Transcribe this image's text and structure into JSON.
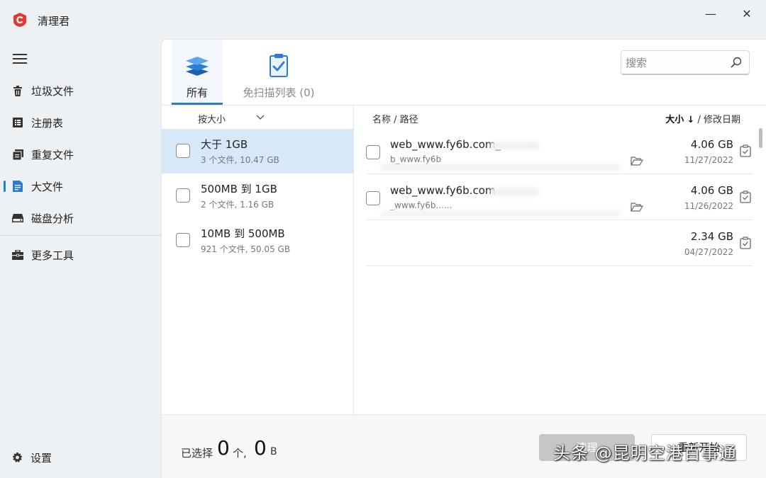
{
  "app": {
    "title": "清理君",
    "minimize_glyph": "—",
    "close_glyph": "✕"
  },
  "sidebar": {
    "items": [
      {
        "label": "垃圾文件",
        "icon": "trash-icon"
      },
      {
        "label": "注册表",
        "icon": "registry-icon"
      },
      {
        "label": "重复文件",
        "icon": "duplicate-icon"
      },
      {
        "label": "大文件",
        "icon": "large-file-icon",
        "active": true
      },
      {
        "label": "磁盘分析",
        "icon": "disk-icon"
      },
      {
        "label": "更多工具",
        "icon": "toolbox-icon"
      }
    ],
    "settings_label": "设置"
  },
  "tabs": [
    {
      "label": "所有",
      "icon": "layers-icon",
      "active": true
    },
    {
      "label": "免扫描列表 (0)",
      "icon": "clipboard-check-icon",
      "active": false
    }
  ],
  "search": {
    "placeholder": "搜索"
  },
  "left": {
    "sort_label": "按大小",
    "categories": [
      {
        "title": "大于 1GB",
        "sub": "3 个文件, 10.47 GB",
        "selected": true
      },
      {
        "title": "500MB 到 1GB",
        "sub": "2 个文件, 1.16 GB",
        "selected": false
      },
      {
        "title": "10MB 到 500MB",
        "sub": "921 个文件, 50.05 GB",
        "selected": false
      }
    ]
  },
  "right": {
    "col_name": "名称 / 路径",
    "col_sort_size": "大小",
    "col_sort_arrow": "↓",
    "col_sort_date": "/ 修改日期",
    "files": [
      {
        "name": "web_www.fy6b.com_",
        "path": "b_www.fy6b",
        "size": "4.06 GB",
        "date": "11/27/2022"
      },
      {
        "name": "web_www.fy6b.com",
        "path": "_www.fy6b......",
        "size": "4.06 GB",
        "date": "11/26/2022"
      },
      {
        "name": "",
        "path": "",
        "size": "2.34 GB",
        "date": "04/27/2022"
      }
    ]
  },
  "bottom": {
    "selected_label": "已选择",
    "selected_count": "0",
    "count_unit": "个,",
    "selected_size": "0",
    "size_unit": "B",
    "clean_label": "清理",
    "rescan_label": "重新开始"
  },
  "watermark": "头条 @昆明空港百事通",
  "colors": {
    "accent": "#2b7cd3",
    "selected_row": "#d7e8f8",
    "logo_red": "#e23c32"
  }
}
